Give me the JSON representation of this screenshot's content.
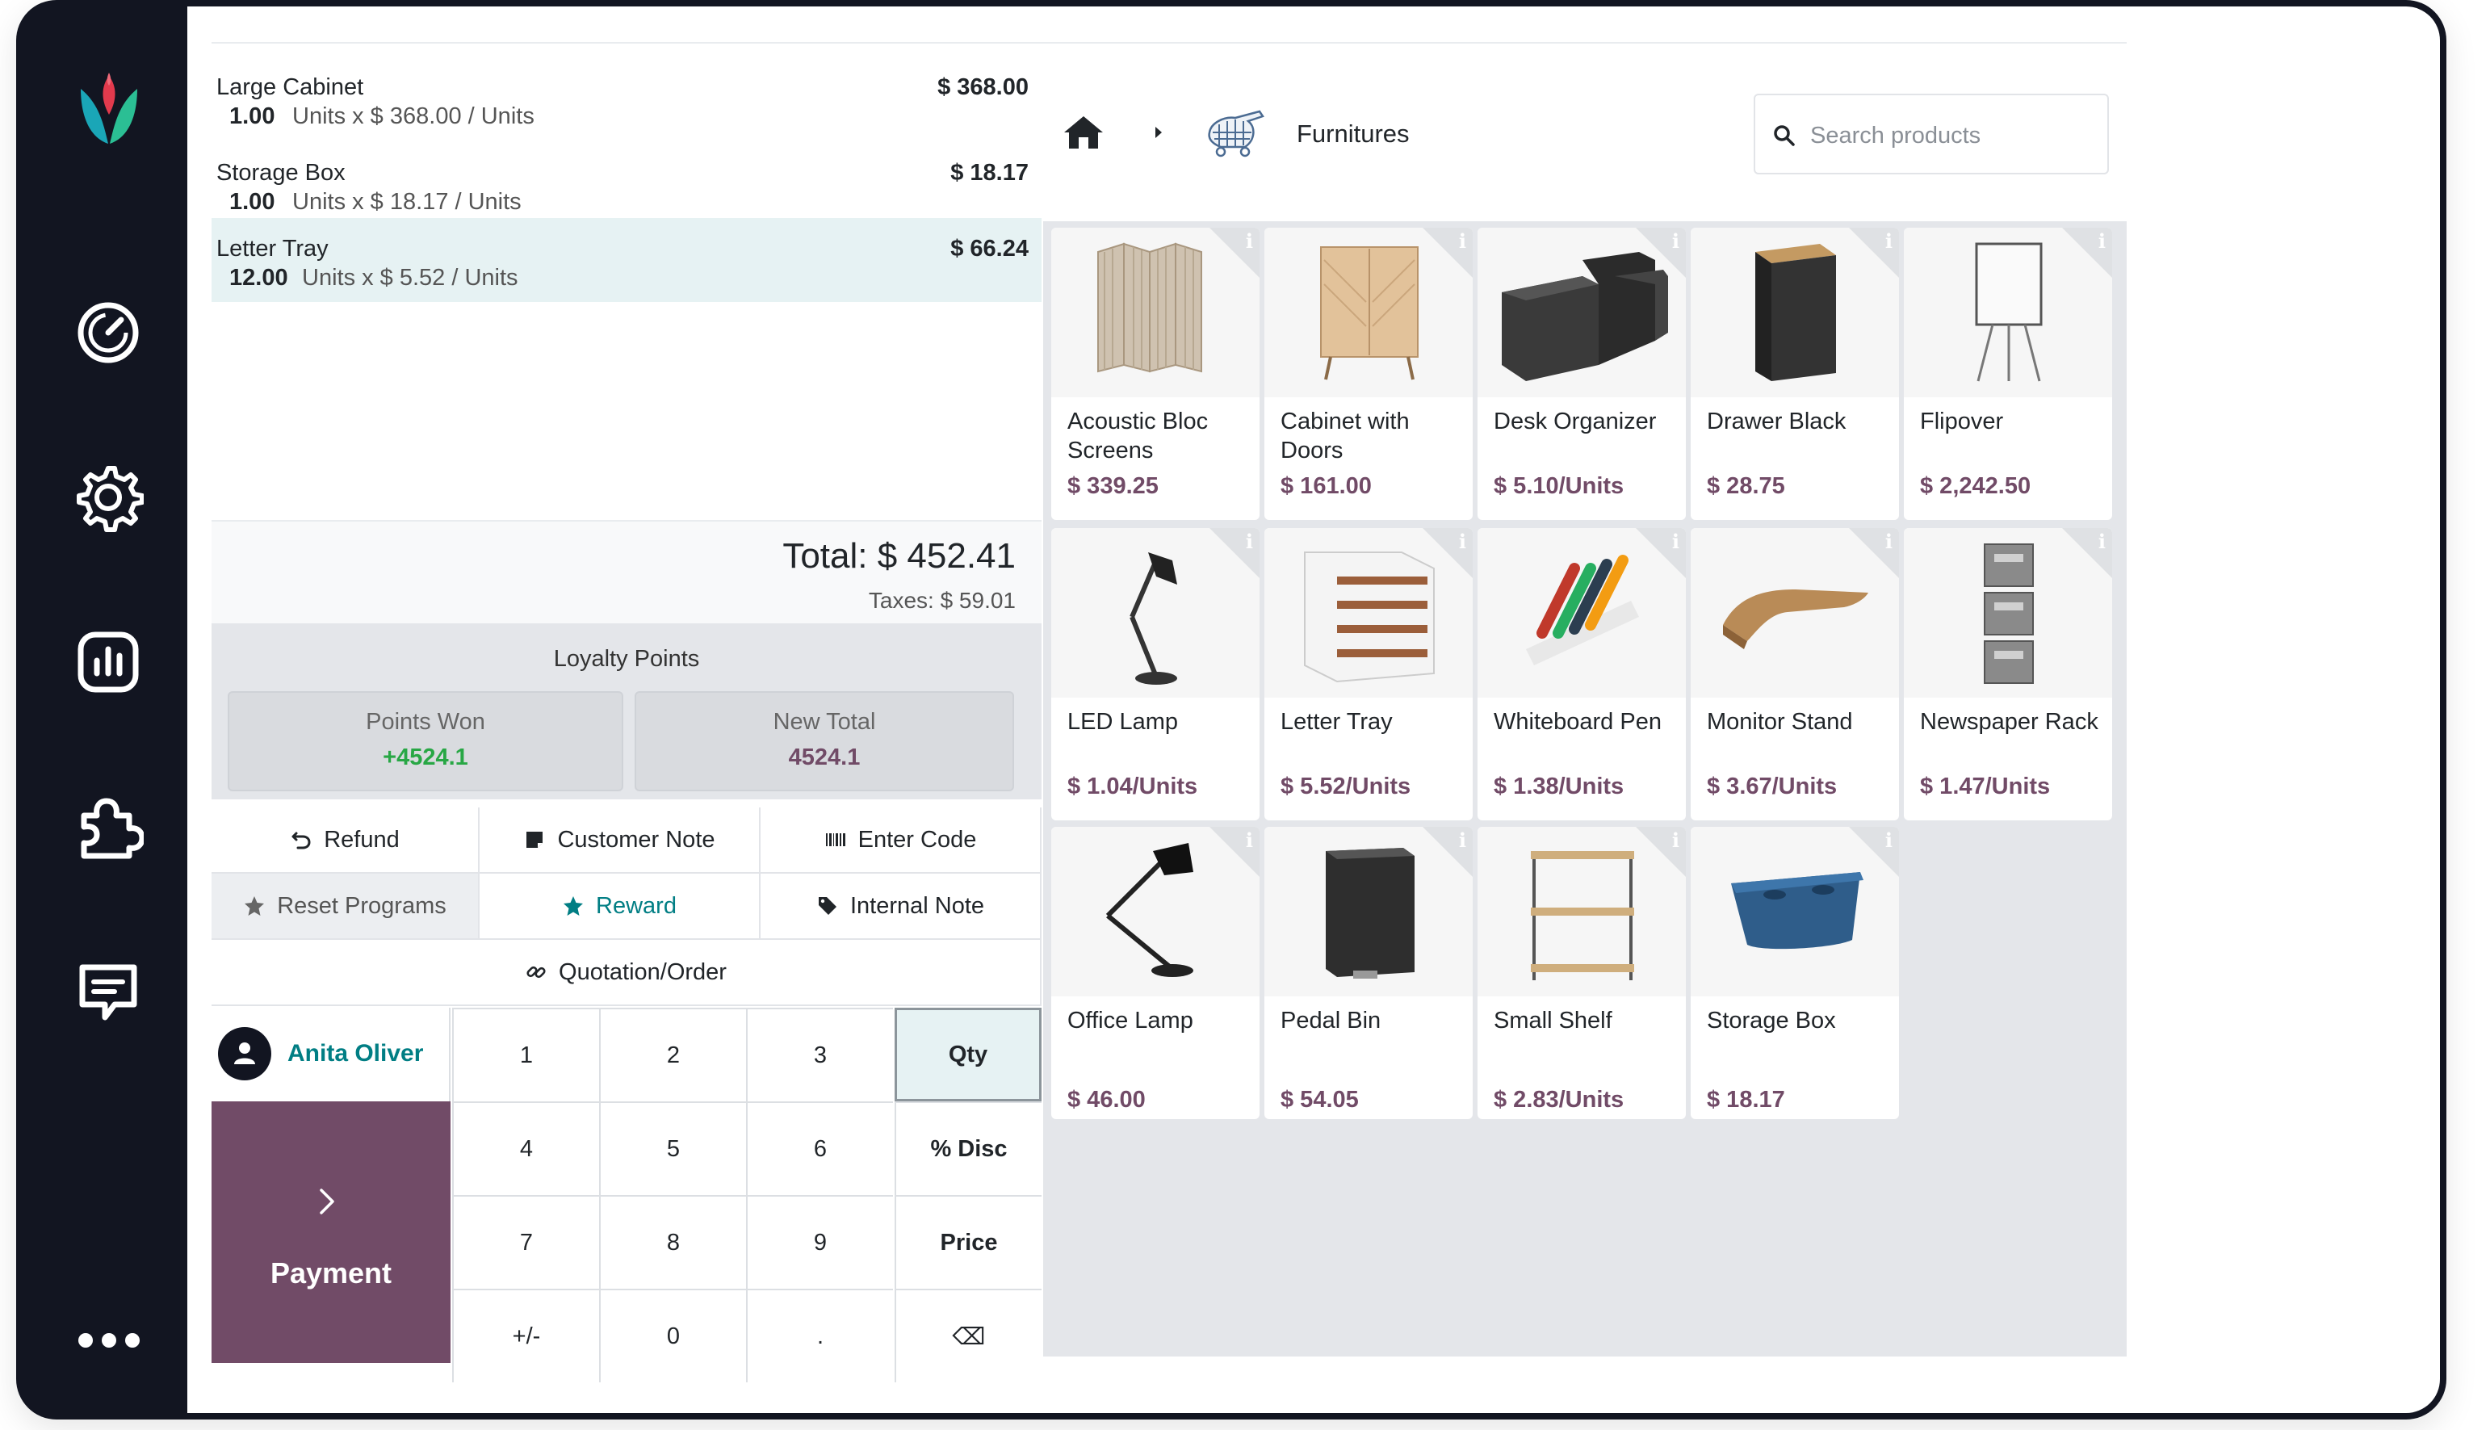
{
  "order": {
    "lines": [
      {
        "name": "Large Cabinet",
        "price": "$ 368.00",
        "qty": "1.00",
        "detail": "Units x $ 368.00 / Units"
      },
      {
        "name": "Storage Box",
        "price": "$ 18.17",
        "qty": "1.00",
        "detail": "Units x $ 18.17 / Units"
      },
      {
        "name": "Letter Tray",
        "price": "$ 66.24",
        "qty": "12.00",
        "detail": "Units x $ 5.52 / Units"
      }
    ],
    "total": "Total: $ 452.41",
    "taxes": "Taxes: $ 59.01"
  },
  "loyalty": {
    "title": "Loyalty Points",
    "points_won_label": "Points Won",
    "points_won_value": "+4524.1",
    "new_total_label": "New Total",
    "new_total_value": "4524.1"
  },
  "controls": {
    "refund": "Refund",
    "customer_note": "Customer Note",
    "enter_code": "Enter Code",
    "reset_programs": "Reset Programs",
    "reward": "Reward",
    "internal_note": "Internal Note",
    "quotation": "Quotation/Order"
  },
  "customer": {
    "name": "Anita Oliver"
  },
  "payment": {
    "label": "Payment"
  },
  "numpad": {
    "k1": "1",
    "k2": "2",
    "k3": "3",
    "qty": "Qty",
    "k4": "4",
    "k5": "5",
    "k6": "6",
    "disc": "% Disc",
    "k7": "7",
    "k8": "8",
    "k9": "9",
    "price": "Price",
    "plusminus": "+/-",
    "k0": "0",
    "dot": ".",
    "backspace": "⌫"
  },
  "breadcrumb": {
    "category": "Furnitures"
  },
  "search": {
    "placeholder": "Search products"
  },
  "products": [
    {
      "name": "Acoustic Bloc Screens",
      "price": "$ 339.25"
    },
    {
      "name": "Cabinet with Doors",
      "price": "$ 161.00"
    },
    {
      "name": "Desk Organizer",
      "price": "$ 5.10/Units"
    },
    {
      "name": "Drawer Black",
      "price": "$ 28.75"
    },
    {
      "name": "Flipover",
      "price": "$ 2,242.50"
    },
    {
      "name": "LED Lamp",
      "price": "$ 1.04/Units"
    },
    {
      "name": "Letter Tray",
      "price": "$ 5.52/Units"
    },
    {
      "name": "Whiteboard Pen",
      "price": "$ 1.38/Units"
    },
    {
      "name": "Monitor Stand",
      "price": "$ 3.67/Units"
    },
    {
      "name": "Newspaper Rack",
      "price": "$ 1.47/Units"
    },
    {
      "name": "Office Lamp",
      "price": "$ 46.00"
    },
    {
      "name": "Pedal Bin",
      "price": "$ 54.05"
    },
    {
      "name": "Small Shelf",
      "price": "$ 2.83/Units"
    },
    {
      "name": "Storage Box",
      "price": "$ 18.17"
    }
  ],
  "info_marker": "i",
  "colors": {
    "rail": "#121521",
    "brand": "#714b67",
    "teal": "#017e84",
    "points_green": "#28a745",
    "selected_line": "#e6f2f3"
  }
}
